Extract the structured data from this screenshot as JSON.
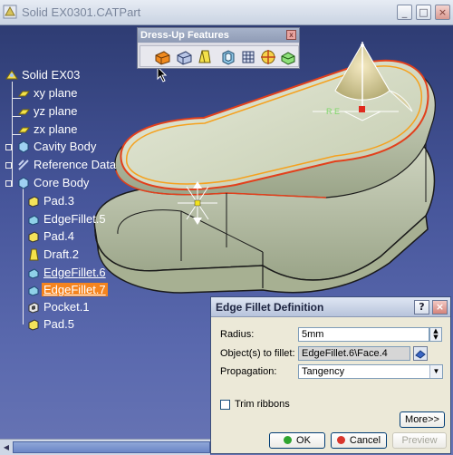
{
  "window": {
    "title": "Solid EX0301.CATPart",
    "min_label": "_",
    "max_label": "□",
    "close_label": "×"
  },
  "toolbar": {
    "title": "Dress-Up Features",
    "close_label": "x",
    "icons": [
      "fillet-icon",
      "chamfer-icon",
      "draft-icon",
      "shell-icon",
      "thickness-icon",
      "thread-icon",
      "remove-face-icon"
    ]
  },
  "tree": {
    "items": [
      {
        "label": "Solid EX03",
        "icon": "part-icon"
      },
      {
        "label": "xy plane",
        "icon": "plane-icon"
      },
      {
        "label": "yz plane",
        "icon": "plane-icon"
      },
      {
        "label": "zx plane",
        "icon": "plane-icon"
      },
      {
        "label": "Cavity Body",
        "icon": "body-icon"
      },
      {
        "label": "Reference Data",
        "icon": "geometrical-set-icon"
      },
      {
        "label": "Core Body",
        "icon": "body-icon"
      },
      {
        "label": "Pad.3",
        "icon": "pad-icon"
      },
      {
        "label": "EdgeFillet.5",
        "icon": "edge-fillet-icon"
      },
      {
        "label": "Pad.4",
        "icon": "pad-icon"
      },
      {
        "label": "Draft.2",
        "icon": "draft-icon"
      },
      {
        "label": "EdgeFillet.6",
        "icon": "edge-fillet-icon"
      },
      {
        "label": "EdgeFillet.7",
        "icon": "edge-fillet-icon"
      },
      {
        "label": "Pocket.1",
        "icon": "pocket-icon"
      },
      {
        "label": "Pad.5",
        "icon": "pad-icon"
      }
    ]
  },
  "compass": {
    "label": "R E"
  },
  "dialog": {
    "title": "Edge Fillet Definition",
    "help_label": "?",
    "close_label": "×",
    "radius_label": "Radius:",
    "radius_value": "5mm",
    "objects_label": "Object(s) to fillet:",
    "objects_value": "EdgeFillet.6\\Face.4",
    "propagation_label": "Propagation:",
    "propagation_value": "Tangency",
    "trim_ribbons_label": "Trim ribbons",
    "trim_ribbons_checked": false,
    "more_label": "More>>",
    "ok_label": "OK",
    "cancel_label": "Cancel",
    "preview_label": "Preview"
  },
  "colors": {
    "viewport_top": "#2e3c73",
    "viewport_bottom": "#6774b4",
    "part_fill": "#c9d2b8",
    "selection_orange": "#f5841e",
    "ok_green": "#2fa52f",
    "cancel_red": "#d9362c"
  }
}
